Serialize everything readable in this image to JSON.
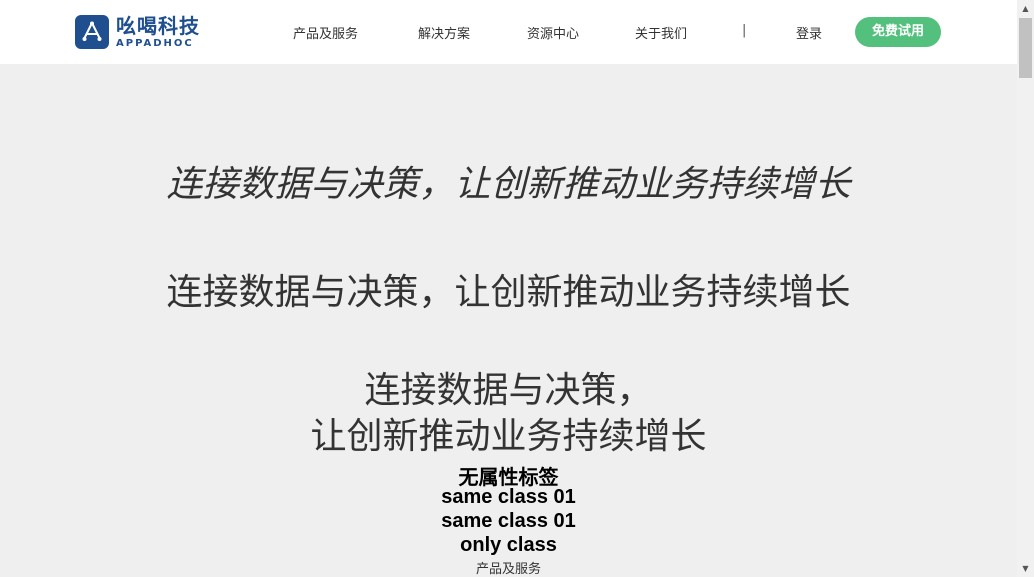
{
  "brand": {
    "name_cn": "吆喝科技",
    "name_en": "APPADHOC"
  },
  "nav": {
    "items": [
      "产品及服务",
      "解决方案",
      "资源中心",
      "关于我们"
    ],
    "separator": "|",
    "login": "登录",
    "cta": "免费试用"
  },
  "colors": {
    "brand": "#1f4f8f",
    "cta": "#54c07d",
    "background": "#efefef"
  },
  "hero": {
    "headline_italic": "连接数据与决策，让创新推动业务持续增长",
    "headline_normal": "连接数据与决策，让创新推动业务持续增长",
    "headline_line1": "连接数据与决策，",
    "headline_line2": "让创新推动业务持续增长"
  },
  "test_labels": {
    "no_attr": "无属性标签",
    "same_class_1": "same class 01",
    "same_class_2": "same class 01",
    "only_class": "only class",
    "small_link": "产品及服务"
  }
}
